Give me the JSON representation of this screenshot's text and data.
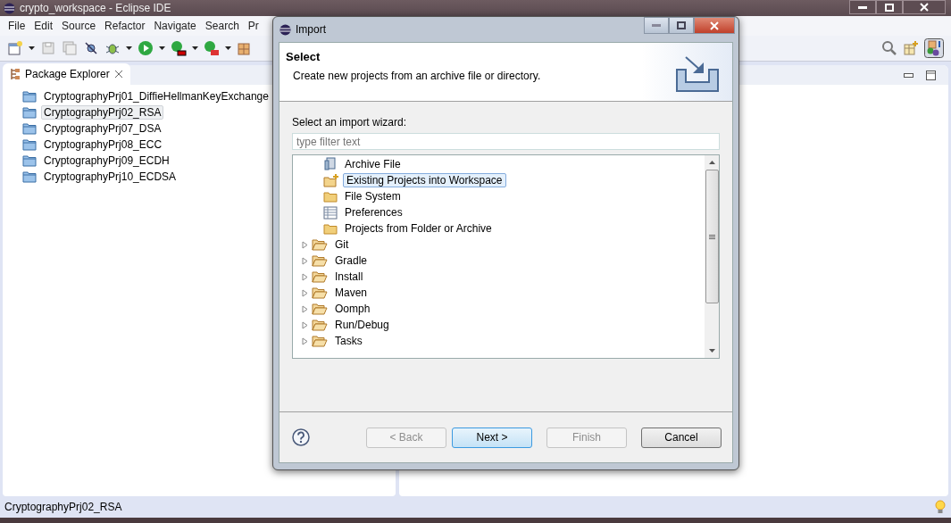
{
  "window": {
    "title": "crypto_workspace - Eclipse IDE"
  },
  "menu": [
    "File",
    "Edit",
    "Source",
    "Refactor",
    "Navigate",
    "Search",
    "Pr"
  ],
  "package_explorer": {
    "title": "Package Explorer",
    "items": [
      {
        "label": "CryptographyPrj01_DiffieHellmanKeyExchange",
        "selected": false
      },
      {
        "label": "CryptographyPrj02_RSA",
        "selected": true
      },
      {
        "label": "CryptographyPrj07_DSA",
        "selected": false
      },
      {
        "label": "CryptographyPrj08_ECC",
        "selected": false
      },
      {
        "label": "CryptographyPrj09_ECDH",
        "selected": false
      },
      {
        "label": "CryptographyPrj10_ECDSA",
        "selected": false
      }
    ]
  },
  "status_bar": {
    "text": "CryptographyPrj02_RSA"
  },
  "dialog": {
    "title": "Import",
    "heading": "Select",
    "description": "Create new projects from an archive file or directory.",
    "wizard_label": "Select an import wizard:",
    "filter": {
      "placeholder": "type filter text"
    },
    "tree": [
      {
        "label": "Archive File",
        "kind": "archive",
        "selected": false
      },
      {
        "label": "Existing Projects into Workspace",
        "kind": "project",
        "selected": true
      },
      {
        "label": "File System",
        "kind": "folder",
        "selected": false
      },
      {
        "label": "Preferences",
        "kind": "prefs",
        "selected": false
      },
      {
        "label": "Projects from Folder or Archive",
        "kind": "folder",
        "selected": false
      },
      {
        "label": "Git",
        "kind": "category",
        "expanded": false,
        "selected": false
      },
      {
        "label": "Gradle",
        "kind": "category",
        "expanded": false,
        "selected": false
      },
      {
        "label": "Install",
        "kind": "category",
        "expanded": false,
        "selected": false
      },
      {
        "label": "Maven",
        "kind": "category",
        "expanded": false,
        "selected": false
      },
      {
        "label": "Oomph",
        "kind": "category",
        "expanded": false,
        "selected": false
      },
      {
        "label": "Run/Debug",
        "kind": "category",
        "expanded": false,
        "selected": false
      },
      {
        "label": "Tasks",
        "kind": "category",
        "expanded": false,
        "selected": false
      }
    ],
    "buttons": [
      {
        "label": "< Back",
        "disabled": true,
        "default": false
      },
      {
        "label": "Next >",
        "disabled": false,
        "default": true
      },
      {
        "label": "Finish",
        "disabled": true,
        "default": false
      },
      {
        "label": "Cancel",
        "disabled": false,
        "default": false
      }
    ]
  }
}
